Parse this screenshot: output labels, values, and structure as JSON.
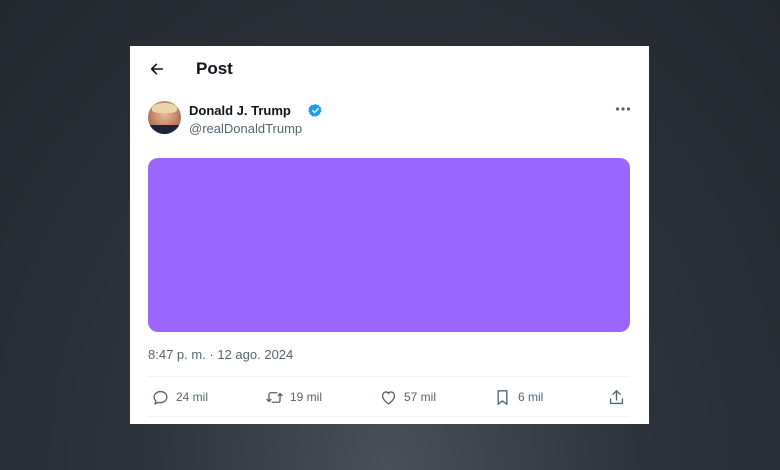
{
  "header": {
    "title": "Post"
  },
  "author": {
    "display_name": "Donald J. Trump",
    "handle": "@realDonaldTrump"
  },
  "media": {
    "color": "#9b66fe"
  },
  "timestamp": "8:47 p. m. · 12 ago. 2024",
  "actions": {
    "replies": "24 mil",
    "reposts": "19 mil",
    "likes": "57 mil",
    "bookmarks": "6 mil"
  },
  "colors": {
    "accent": "#1d9bf0",
    "text": "#0f1419",
    "muted": "#536471"
  },
  "icons": [
    "back-arrow-icon",
    "verified-badge-icon",
    "more-options-icon",
    "reply-icon",
    "repost-icon",
    "like-icon",
    "bookmark-icon",
    "share-icon"
  ]
}
